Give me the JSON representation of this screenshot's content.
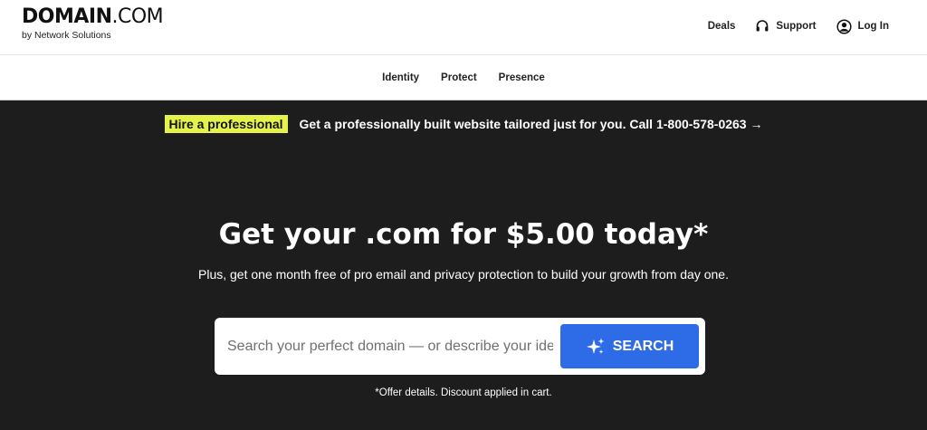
{
  "header": {
    "logo_main": "DOMAIN",
    "logo_dotcom": ".COM",
    "logo_sub": "by Network Solutions",
    "links": [
      {
        "label": "Deals",
        "icon": "none"
      },
      {
        "label": "Support",
        "icon": "headset-icon"
      },
      {
        "label": "Log In",
        "icon": "user-circle-icon"
      }
    ]
  },
  "nav": {
    "items": [
      "Identity",
      "Protect",
      "Presence"
    ]
  },
  "promo": {
    "tag": "Hire a professional",
    "text": "Get a professionally built website tailored just for you. Call 1-800-578-0263 →"
  },
  "hero": {
    "title": "Get your .com for $5.00 today*",
    "subtitle": "Plus, get one month free of pro email and privacy protection to build your growth from day one."
  },
  "search": {
    "placeholder": "Search your perfect domain — or describe your idea",
    "button_label": "SEARCH",
    "button_icon": "sparkle-icon"
  },
  "offer": {
    "link": "*Offer details",
    "text": ". Discount applied in cart."
  },
  "colors": {
    "background": "#1d1d1d",
    "promo_tag": "#e4f24a",
    "search_button": "#2e6be6"
  }
}
